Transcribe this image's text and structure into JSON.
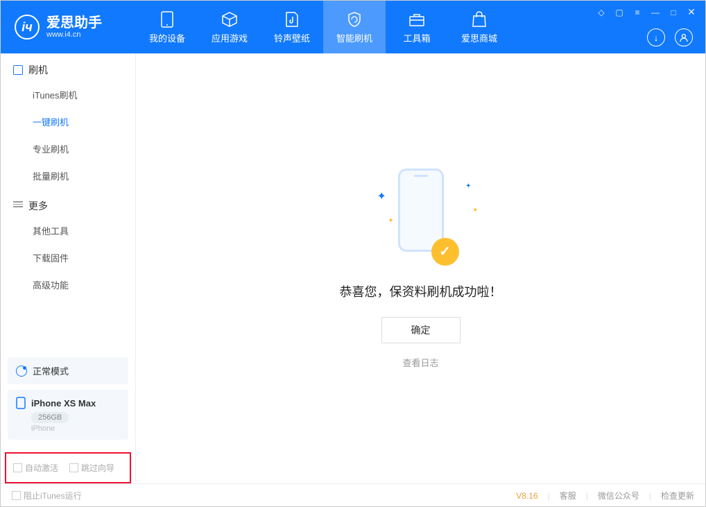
{
  "app": {
    "title": "爱思助手",
    "subtitle": "www.i4.cn"
  },
  "nav": {
    "my_device": "我的设备",
    "apps_games": "应用游戏",
    "ring_wall": "铃声壁纸",
    "smart_flash": "智能刷机",
    "toolbox": "工具箱",
    "store": "爱思商城"
  },
  "sidebar": {
    "section_flash": "刷机",
    "itunes_flash": "iTunes刷机",
    "oneclick_flash": "一键刷机",
    "pro_flash": "专业刷机",
    "batch_flash": "批量刷机",
    "section_more": "更多",
    "other_tools": "其他工具",
    "download_fw": "下载固件",
    "advanced": "高级功能"
  },
  "mode_card": {
    "label": "正常模式"
  },
  "device_card": {
    "name": "iPhone XS Max",
    "storage": "256GB",
    "type": "iPhone"
  },
  "options": {
    "auto_activate": "自动激活",
    "skip_guide": "跳过向导"
  },
  "main": {
    "success_text": "恭喜您，保资料刷机成功啦！",
    "ok": "确定",
    "view_log": "查看日志"
  },
  "footer": {
    "block_itunes": "阻止iTunes运行",
    "version": "V8.16",
    "support": "客服",
    "wechat": "微信公众号",
    "check_update": "检查更新"
  }
}
